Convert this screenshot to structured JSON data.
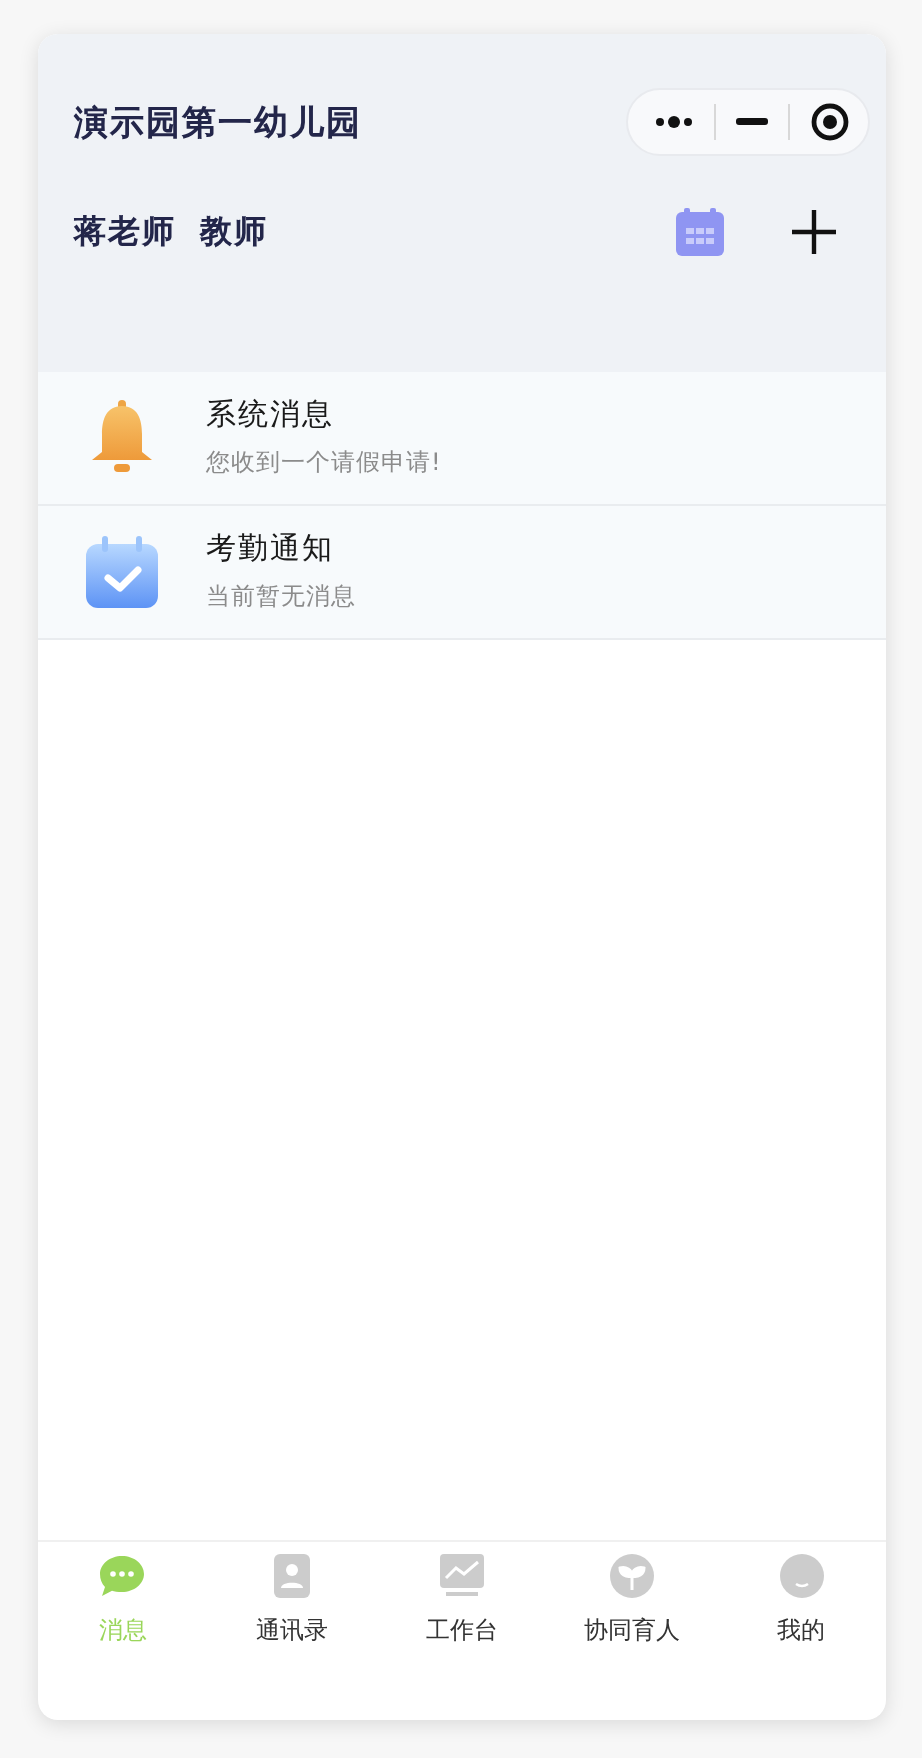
{
  "header": {
    "title": "演示园第一幼儿园",
    "user_name": "蒋老师",
    "role": "教师"
  },
  "messages": [
    {
      "kind": "bell",
      "title": "系统消息",
      "subtitle": "您收到一个请假申请!"
    },
    {
      "kind": "calendar",
      "title": "考勤通知",
      "subtitle": "当前暂无消息"
    }
  ],
  "tabs": [
    {
      "kind": "chat",
      "label": "消息",
      "selected": true
    },
    {
      "kind": "contacts",
      "label": "通讯录",
      "selected": false
    },
    {
      "kind": "chart",
      "label": "工作台",
      "selected": false
    },
    {
      "kind": "sprout",
      "label": "协同育人",
      "selected": false
    },
    {
      "kind": "face",
      "label": "我的",
      "selected": false
    }
  ]
}
